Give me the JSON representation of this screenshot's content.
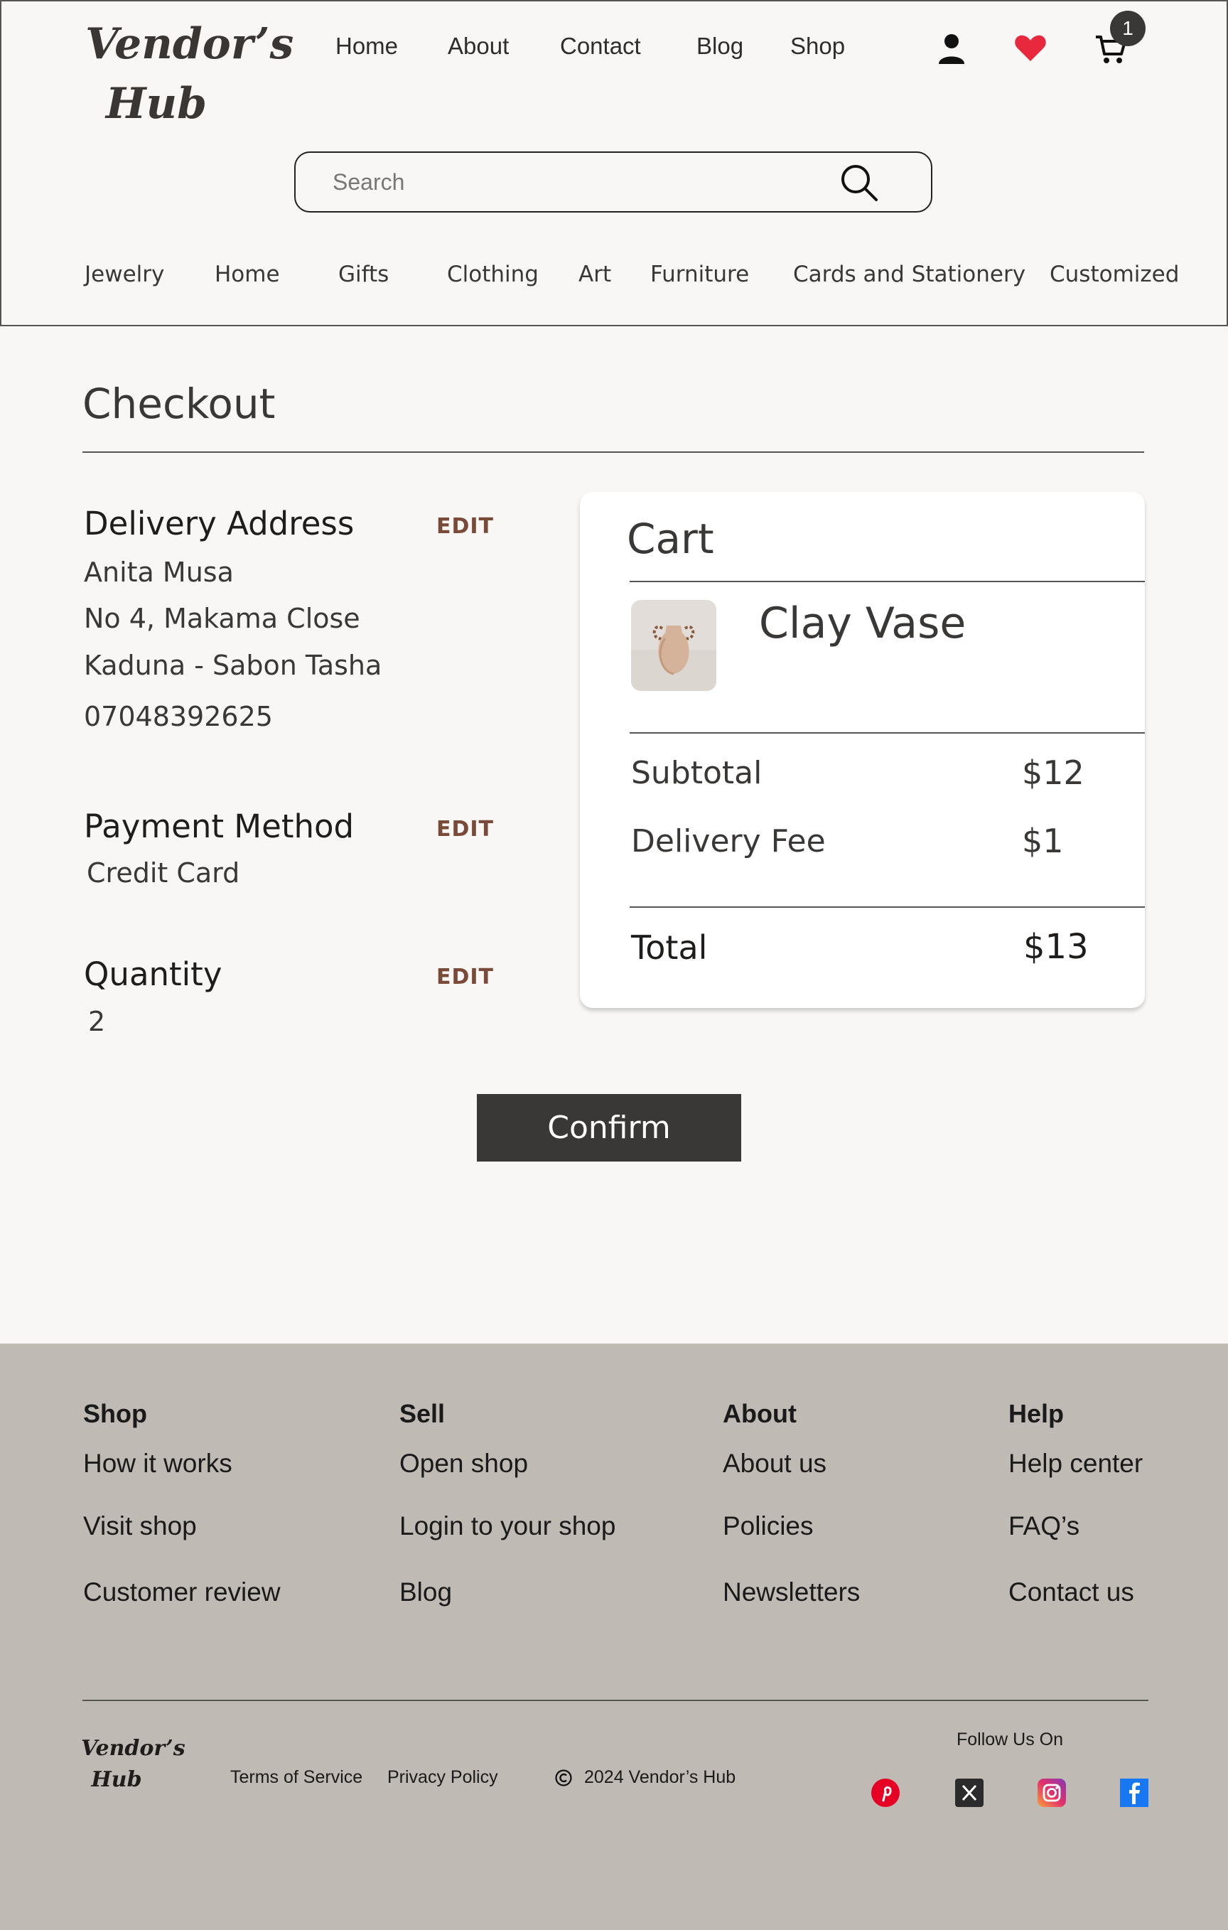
{
  "brand": {
    "name_line1": "Vendor’s",
    "name_line2": "Hub"
  },
  "nav": [
    "Home",
    "About",
    "Contact",
    "Blog",
    "Shop"
  ],
  "header_icons": {
    "account": "user-icon",
    "wishlist": "heart-icon",
    "cart": "cart-icon",
    "cart_count": "1",
    "wishlist_color": "#e8283c"
  },
  "search": {
    "placeholder": "Search",
    "icon": "search-icon"
  },
  "categories": [
    "Jewelry",
    "Home",
    "Gifts",
    "Clothing",
    "Art",
    "Furniture",
    "Cards and Stationery",
    "Customized"
  ],
  "checkout": {
    "title": "Checkout",
    "edit_label": "EDIT",
    "delivery": {
      "heading": "Delivery Address",
      "name": "Anita Musa",
      "street": "No 4, Makama Close",
      "city": "Kaduna - Sabon Tasha",
      "phone": "07048392625"
    },
    "payment": {
      "heading": "Payment Method",
      "value": "Credit Card"
    },
    "quantity": {
      "heading": "Quantity",
      "value": "2"
    },
    "confirm_label": "Confirm"
  },
  "cart": {
    "title": "Cart",
    "item_name": "Clay Vase",
    "subtotal_label": "Subtotal",
    "subtotal": "$12",
    "delivery_label": "Delivery Fee",
    "delivery_fee": "$1",
    "total_label": "Total",
    "total": "$13"
  },
  "footer": {
    "columns": [
      {
        "heading": "Shop",
        "links": [
          "How it works",
          "Visit shop",
          "Customer review"
        ]
      },
      {
        "heading": "Sell",
        "links": [
          "Open shop",
          "Login to your shop",
          "Blog"
        ]
      },
      {
        "heading": "About",
        "links": [
          "About us",
          "Policies",
          "Newsletters"
        ]
      },
      {
        "heading": "Help",
        "links": [
          "Help center",
          "FAQ’s",
          "Contact us"
        ]
      }
    ],
    "terms": "Terms of Service",
    "privacy": "Privacy Policy",
    "copyright": "2024 Vendor’s Hub",
    "follow": "Follow Us On",
    "social": [
      "pinterest-icon",
      "x-icon",
      "instagram-icon",
      "facebook-icon"
    ]
  }
}
